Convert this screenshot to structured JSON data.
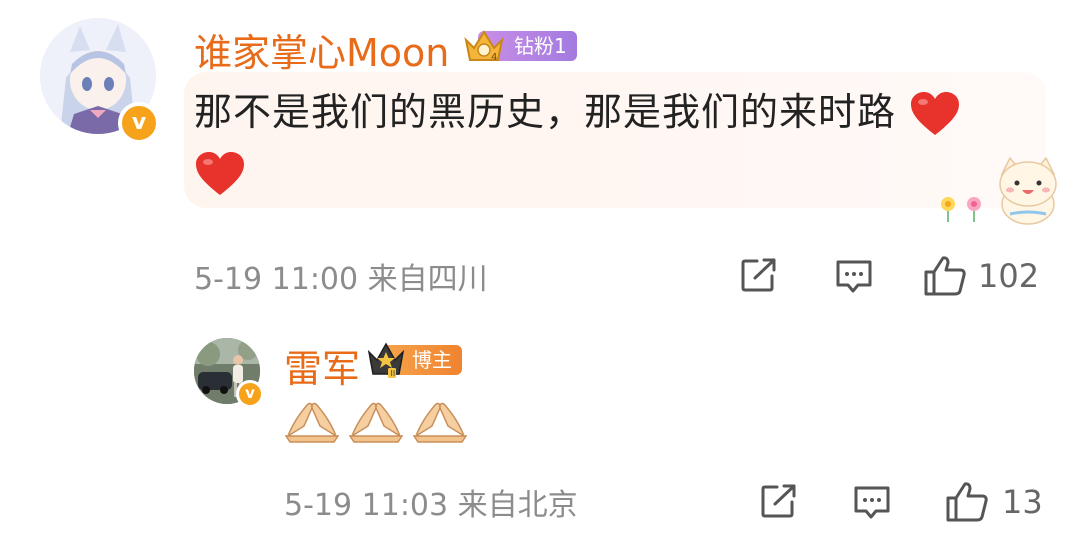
{
  "comment1": {
    "username": "谁家掌心Moon",
    "badge_label": "钻粉1",
    "text": "那不是我们的黑历史，那是我们的来时路",
    "emoji_after_text": "heart-emoji",
    "date": "5-19",
    "time": "11:00",
    "location": "来自四川",
    "likes": "102",
    "icons": [
      "share-icon",
      "comment-icon",
      "like-icon"
    ]
  },
  "comment2": {
    "username": "雷军",
    "badge_label": "博主",
    "emojis": [
      "pray-hands-emoji",
      "pray-hands-emoji",
      "pray-hands-emoji"
    ],
    "date": "5-19",
    "time": "11:03",
    "location": "来自北京",
    "likes": "13",
    "icons": [
      "share-icon",
      "comment-icon",
      "like-icon"
    ]
  },
  "colors": {
    "username": "#e86b1a",
    "meta": "#8c8c8c",
    "verified_badge": "#f7a21b",
    "fan_badge": "#a37ae0",
    "host_badge": "#f08330"
  }
}
